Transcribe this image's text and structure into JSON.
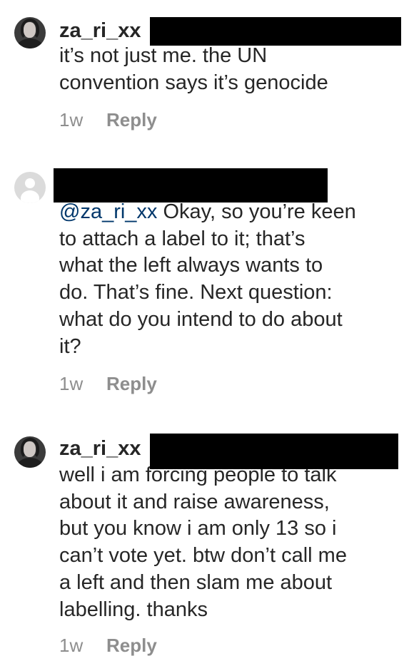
{
  "comments": [
    {
      "username": "za_ri_xx",
      "lines": [
        "it’s not just me. the UN",
        "convention says it’s genocide"
      ],
      "time": "1w",
      "reply_label": "Reply"
    },
    {
      "username": "",
      "mention": "@za_ri_xx",
      "lines": [
        " Okay, so you’re keen",
        "to attach a label to it; that’s",
        "what the left always wants to",
        "do. That’s fine. Next question:",
        "what do you intend to do about",
        "it?"
      ],
      "time": "1w",
      "reply_label": "Reply"
    },
    {
      "username": "za_ri_xx",
      "lines": [
        "well i am forcing people to talk",
        "about it and raise awareness,",
        "but you know i am only 13 so i",
        "can’t vote yet. btw don’t call me",
        "a left and then slam me about",
        "labelling. thanks"
      ],
      "time": "1w",
      "reply_label": "Reply"
    }
  ]
}
